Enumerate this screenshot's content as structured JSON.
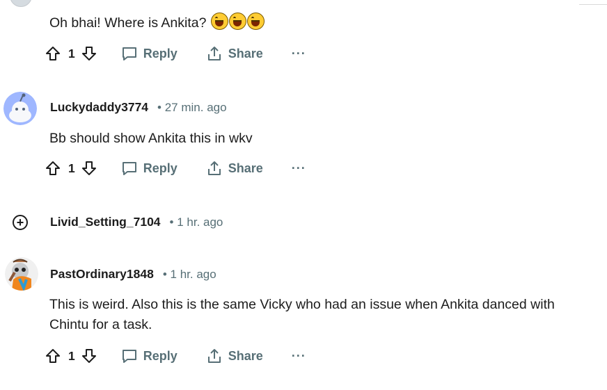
{
  "comments": [
    {
      "text": "Oh bhai! Where is Ankita?",
      "emoji": [
        "grinning-squinting-face",
        "grinning-squinting-face",
        "grinning-squinting-face"
      ],
      "votes": "1",
      "reply_label": "Reply",
      "share_label": "Share",
      "more_label": "···"
    },
    {
      "username": "Luckydaddy3774",
      "time": "• 27 min. ago",
      "text": "Bb should show Ankita this in wkv",
      "votes": "1",
      "reply_label": "Reply",
      "share_label": "Share",
      "more_label": "···"
    },
    {
      "username": "Livid_Setting_7104",
      "time": "• 1 hr. ago",
      "collapsed": true
    },
    {
      "username": "PastOrdinary1848",
      "time": "• 1 hr. ago",
      "text_line1": "This is weird. Also this is the same Vicky who had an issue when Ankita danced with",
      "text_line2": "Chintu for a task.",
      "votes": "1",
      "reply_label": "Reply",
      "share_label": "Share",
      "more_label": "···"
    }
  ],
  "colors": {
    "muted": "#576f76",
    "text": "#1c1c1c",
    "avatar_blue": "#9fb7ff",
    "background": "#ffffff"
  },
  "icons": [
    "upvote-icon",
    "downvote-icon",
    "reply-icon",
    "share-icon",
    "more-icon",
    "expand-thread-icon"
  ]
}
